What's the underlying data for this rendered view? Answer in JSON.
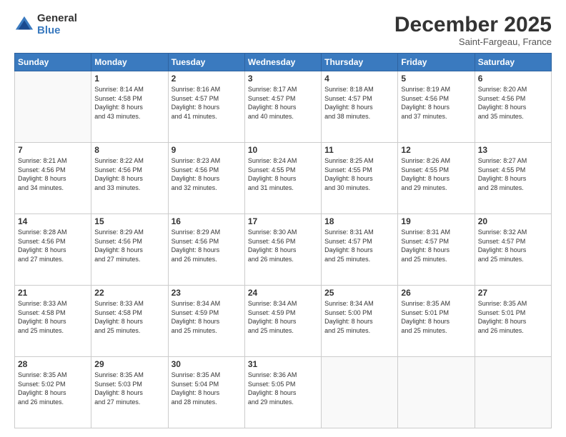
{
  "header": {
    "logo_general": "General",
    "logo_blue": "Blue",
    "month_title": "December 2025",
    "subtitle": "Saint-Fargeau, France"
  },
  "days_of_week": [
    "Sunday",
    "Monday",
    "Tuesday",
    "Wednesday",
    "Thursday",
    "Friday",
    "Saturday"
  ],
  "weeks": [
    [
      {
        "day": "",
        "info": ""
      },
      {
        "day": "1",
        "info": "Sunrise: 8:14 AM\nSunset: 4:58 PM\nDaylight: 8 hours\nand 43 minutes."
      },
      {
        "day": "2",
        "info": "Sunrise: 8:16 AM\nSunset: 4:57 PM\nDaylight: 8 hours\nand 41 minutes."
      },
      {
        "day": "3",
        "info": "Sunrise: 8:17 AM\nSunset: 4:57 PM\nDaylight: 8 hours\nand 40 minutes."
      },
      {
        "day": "4",
        "info": "Sunrise: 8:18 AM\nSunset: 4:57 PM\nDaylight: 8 hours\nand 38 minutes."
      },
      {
        "day": "5",
        "info": "Sunrise: 8:19 AM\nSunset: 4:56 PM\nDaylight: 8 hours\nand 37 minutes."
      },
      {
        "day": "6",
        "info": "Sunrise: 8:20 AM\nSunset: 4:56 PM\nDaylight: 8 hours\nand 35 minutes."
      }
    ],
    [
      {
        "day": "7",
        "info": "Sunrise: 8:21 AM\nSunset: 4:56 PM\nDaylight: 8 hours\nand 34 minutes."
      },
      {
        "day": "8",
        "info": "Sunrise: 8:22 AM\nSunset: 4:56 PM\nDaylight: 8 hours\nand 33 minutes."
      },
      {
        "day": "9",
        "info": "Sunrise: 8:23 AM\nSunset: 4:56 PM\nDaylight: 8 hours\nand 32 minutes."
      },
      {
        "day": "10",
        "info": "Sunrise: 8:24 AM\nSunset: 4:55 PM\nDaylight: 8 hours\nand 31 minutes."
      },
      {
        "day": "11",
        "info": "Sunrise: 8:25 AM\nSunset: 4:55 PM\nDaylight: 8 hours\nand 30 minutes."
      },
      {
        "day": "12",
        "info": "Sunrise: 8:26 AM\nSunset: 4:55 PM\nDaylight: 8 hours\nand 29 minutes."
      },
      {
        "day": "13",
        "info": "Sunrise: 8:27 AM\nSunset: 4:55 PM\nDaylight: 8 hours\nand 28 minutes."
      }
    ],
    [
      {
        "day": "14",
        "info": "Sunrise: 8:28 AM\nSunset: 4:56 PM\nDaylight: 8 hours\nand 27 minutes."
      },
      {
        "day": "15",
        "info": "Sunrise: 8:29 AM\nSunset: 4:56 PM\nDaylight: 8 hours\nand 27 minutes."
      },
      {
        "day": "16",
        "info": "Sunrise: 8:29 AM\nSunset: 4:56 PM\nDaylight: 8 hours\nand 26 minutes."
      },
      {
        "day": "17",
        "info": "Sunrise: 8:30 AM\nSunset: 4:56 PM\nDaylight: 8 hours\nand 26 minutes."
      },
      {
        "day": "18",
        "info": "Sunrise: 8:31 AM\nSunset: 4:57 PM\nDaylight: 8 hours\nand 25 minutes."
      },
      {
        "day": "19",
        "info": "Sunrise: 8:31 AM\nSunset: 4:57 PM\nDaylight: 8 hours\nand 25 minutes."
      },
      {
        "day": "20",
        "info": "Sunrise: 8:32 AM\nSunset: 4:57 PM\nDaylight: 8 hours\nand 25 minutes."
      }
    ],
    [
      {
        "day": "21",
        "info": "Sunrise: 8:33 AM\nSunset: 4:58 PM\nDaylight: 8 hours\nand 25 minutes."
      },
      {
        "day": "22",
        "info": "Sunrise: 8:33 AM\nSunset: 4:58 PM\nDaylight: 8 hours\nand 25 minutes."
      },
      {
        "day": "23",
        "info": "Sunrise: 8:34 AM\nSunset: 4:59 PM\nDaylight: 8 hours\nand 25 minutes."
      },
      {
        "day": "24",
        "info": "Sunrise: 8:34 AM\nSunset: 4:59 PM\nDaylight: 8 hours\nand 25 minutes."
      },
      {
        "day": "25",
        "info": "Sunrise: 8:34 AM\nSunset: 5:00 PM\nDaylight: 8 hours\nand 25 minutes."
      },
      {
        "day": "26",
        "info": "Sunrise: 8:35 AM\nSunset: 5:01 PM\nDaylight: 8 hours\nand 25 minutes."
      },
      {
        "day": "27",
        "info": "Sunrise: 8:35 AM\nSunset: 5:01 PM\nDaylight: 8 hours\nand 26 minutes."
      }
    ],
    [
      {
        "day": "28",
        "info": "Sunrise: 8:35 AM\nSunset: 5:02 PM\nDaylight: 8 hours\nand 26 minutes."
      },
      {
        "day": "29",
        "info": "Sunrise: 8:35 AM\nSunset: 5:03 PM\nDaylight: 8 hours\nand 27 minutes."
      },
      {
        "day": "30",
        "info": "Sunrise: 8:35 AM\nSunset: 5:04 PM\nDaylight: 8 hours\nand 28 minutes."
      },
      {
        "day": "31",
        "info": "Sunrise: 8:36 AM\nSunset: 5:05 PM\nDaylight: 8 hours\nand 29 minutes."
      },
      {
        "day": "",
        "info": ""
      },
      {
        "day": "",
        "info": ""
      },
      {
        "day": "",
        "info": ""
      }
    ]
  ]
}
